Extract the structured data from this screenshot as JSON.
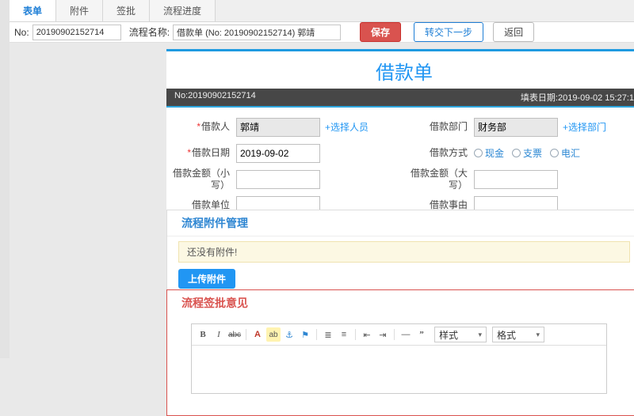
{
  "colors": {
    "accent_blue": "#2196f3",
    "save_red": "#d9534f",
    "approval_red": "#d9534f",
    "notice_bg": "#fcf8e3",
    "meta_bar_bg": "#474747"
  },
  "icons": {
    "chevron_down": "▾"
  },
  "tabs": [
    {
      "label": "表单"
    },
    {
      "label": "附件"
    },
    {
      "label": "签批"
    },
    {
      "label": "流程进度"
    }
  ],
  "toolbar": {
    "no_label": "No:",
    "no_value": "20190902152714",
    "process_label": "流程名称:",
    "process_value": "借款单 (No: 20190902152714) 郭靖",
    "save_label": "保存",
    "next_label": "转交下一步",
    "back_label": "返回"
  },
  "form": {
    "title": "借款单",
    "no_text": "No:20190902152714",
    "date_text": "填表日期:2019-09-02 15:27:1",
    "borrower": {
      "required": "*",
      "label": "借款人",
      "value": "郭靖",
      "link": "+选择人员"
    },
    "department": {
      "label": "借款部门",
      "value": "财务部",
      "link": "+选择部门"
    },
    "borrow_date": {
      "required": "*",
      "label": "借款日期",
      "value": "2019-09-02"
    },
    "method": {
      "label": "借款方式",
      "options": [
        {
          "label": "现金"
        },
        {
          "label": "支票"
        },
        {
          "label": "电汇"
        }
      ]
    },
    "amount_small": {
      "label": "借款金额（小写）",
      "value": ""
    },
    "amount_big": {
      "label": "借款金额（大写）",
      "value": ""
    },
    "unit": {
      "label": "借款单位",
      "value": ""
    },
    "reason": {
      "label": "借款事由",
      "value": ""
    }
  },
  "attachments": {
    "header": "流程附件管理",
    "empty_notice": "还没有附件!",
    "upload_label": "上传附件"
  },
  "approval": {
    "header": "流程签批意见",
    "editor_toolbar": [
      {
        "name": "bold",
        "glyph": "B"
      },
      {
        "name": "italic",
        "glyph": "I"
      },
      {
        "name": "strikethrough",
        "glyph": "abc"
      },
      {
        "name": "font-color",
        "glyph": "A"
      },
      {
        "name": "background-color",
        "glyph": "ab"
      },
      {
        "name": "anchor",
        "glyph": "⚓"
      },
      {
        "name": "flag",
        "glyph": "⚑"
      },
      {
        "name": "numbered-list",
        "glyph": "≣"
      },
      {
        "name": "bullet-list",
        "glyph": "≡"
      },
      {
        "name": "outdent",
        "glyph": "⇤"
      },
      {
        "name": "indent",
        "glyph": "⇥"
      },
      {
        "name": "horizontal-rule",
        "glyph": "—"
      },
      {
        "name": "quote",
        "glyph": "”"
      }
    ],
    "style_select": "样式",
    "format_select": "格式"
  }
}
